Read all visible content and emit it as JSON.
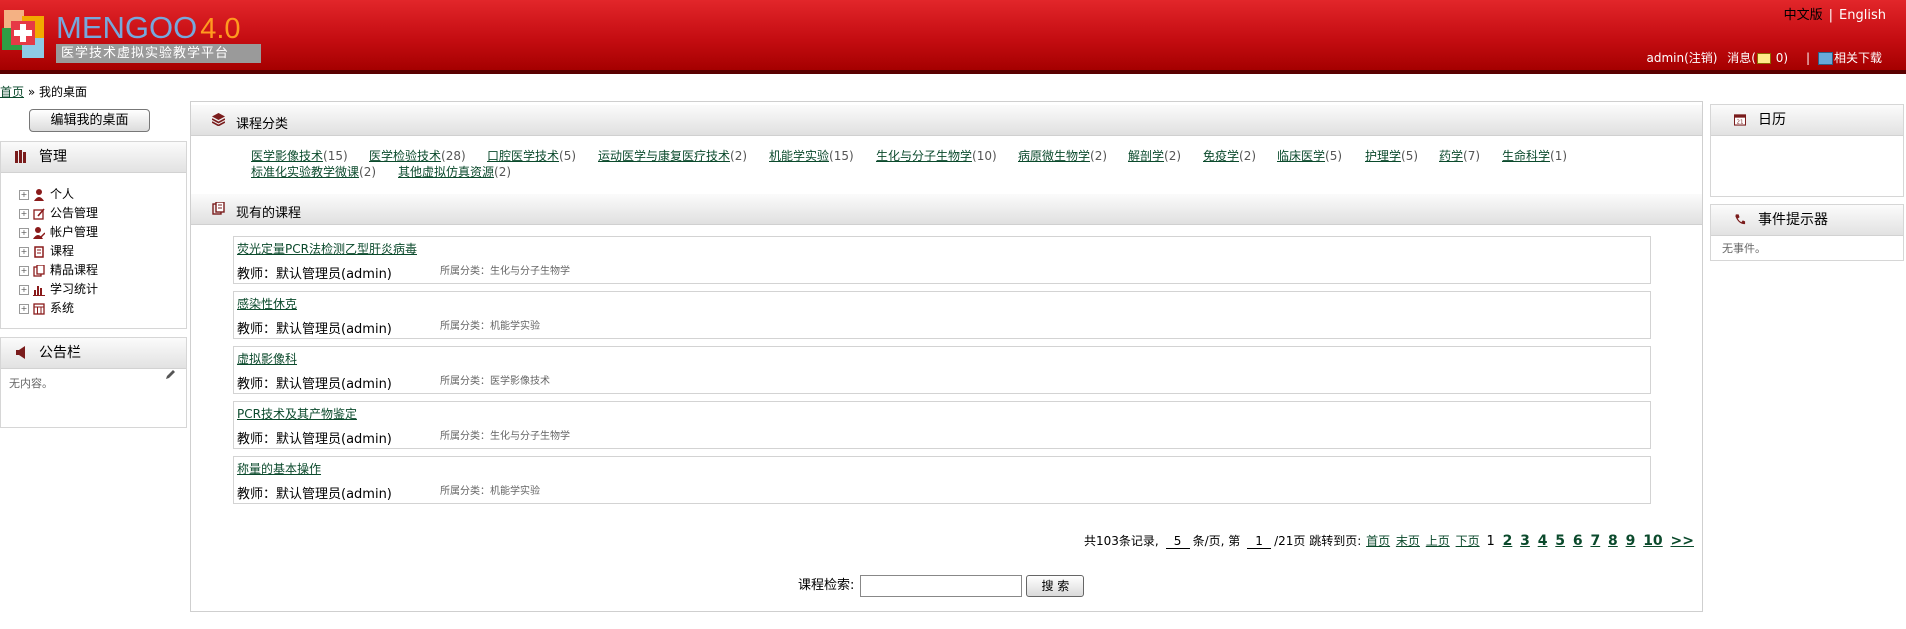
{
  "header": {
    "logo_title": "MENGOO",
    "logo_version": "4.0",
    "logo_subtitle": "医学技术虚拟实验教学平台",
    "lang_cn": "中文版",
    "lang_sep": "|",
    "lang_en": "English",
    "user": "admin(注销)",
    "messages_prefix": "消息(",
    "messages_count": "0",
    "messages_suffix": ")",
    "bar_sep": "|",
    "downloads": "相关下载"
  },
  "breadcrumb": {
    "home": "首页",
    "sep": "»",
    "current": "我的桌面"
  },
  "left": {
    "edit_desktop": "编辑我的桌面",
    "manage_title": "管理",
    "tree": [
      "个人",
      "公告管理",
      "帐户管理",
      "课程",
      "精品课程",
      "学习统计",
      "系统"
    ],
    "bulletin_title": "公告栏",
    "bulletin_empty": "无内容。"
  },
  "main": {
    "category_title": "课程分类",
    "categories": [
      {
        "name": "医学影像技术",
        "count": "(15)"
      },
      {
        "name": "医学检验技术",
        "count": "(28)"
      },
      {
        "name": "口腔医学技术",
        "count": "(5)"
      },
      {
        "name": "运动医学与康复医疗技术",
        "count": "(2)"
      },
      {
        "name": "机能学实验",
        "count": "(15)"
      },
      {
        "name": "生化与分子生物学",
        "count": "(10)"
      },
      {
        "name": "病原微生物学",
        "count": "(2)"
      },
      {
        "name": "解剖学",
        "count": "(2)"
      },
      {
        "name": "免疫学",
        "count": "(2)"
      },
      {
        "name": "临床医学",
        "count": "(5)"
      },
      {
        "name": "护理学",
        "count": "(5)"
      },
      {
        "name": "药学",
        "count": "(7)"
      },
      {
        "name": "生命科学",
        "count": "(1)"
      },
      {
        "name": "标准化实验教学微课",
        "count": "(2)"
      },
      {
        "name": "其他虚拟仿真资源",
        "count": "(2)"
      }
    ],
    "courses_title": "现有的课程",
    "courses": [
      {
        "name": "荧光定量PCR法检测乙型肝炎病毒",
        "teacher": "教师：默认管理员(admin)",
        "category": "所属分类：生化与分子生物学"
      },
      {
        "name": "感染性休克",
        "teacher": "教师：默认管理员(admin)",
        "category": "所属分类：机能学实验"
      },
      {
        "name": "虚拟影像科",
        "teacher": "教师：默认管理员(admin)",
        "category": "所属分类：医学影像技术"
      },
      {
        "name": "PCR技术及其产物鉴定",
        "teacher": "教师：默认管理员(admin)",
        "category": "所属分类：生化与分子生物学"
      },
      {
        "name": "称量的基本操作",
        "teacher": "教师：默认管理员(admin)",
        "category": "所属分类：机能学实验"
      }
    ],
    "pager": {
      "total": "共103条记录,",
      "per_page_value": "5",
      "per_page_suffix": "条/页, 第",
      "page_value": "1",
      "page_suffix": "/21页 跳转到页:",
      "first": "首页",
      "last": "末页",
      "prev": "上页",
      "next": "下页",
      "current": "1",
      "pages": [
        "2",
        "3",
        "4",
        "5",
        "6",
        "7",
        "8",
        "9",
        "10"
      ],
      "more": ">>"
    },
    "search_label": "课程检索:",
    "search_button": "搜 索"
  },
  "right": {
    "calendar_title": "日历",
    "events_title": "事件提示器",
    "events_empty": "无事件。"
  },
  "colors": {
    "header_red": "#c50d12",
    "link_green": "#0b4a2c",
    "logo_blue": "#76a8dc",
    "logo_orange": "#ff9a1f"
  }
}
